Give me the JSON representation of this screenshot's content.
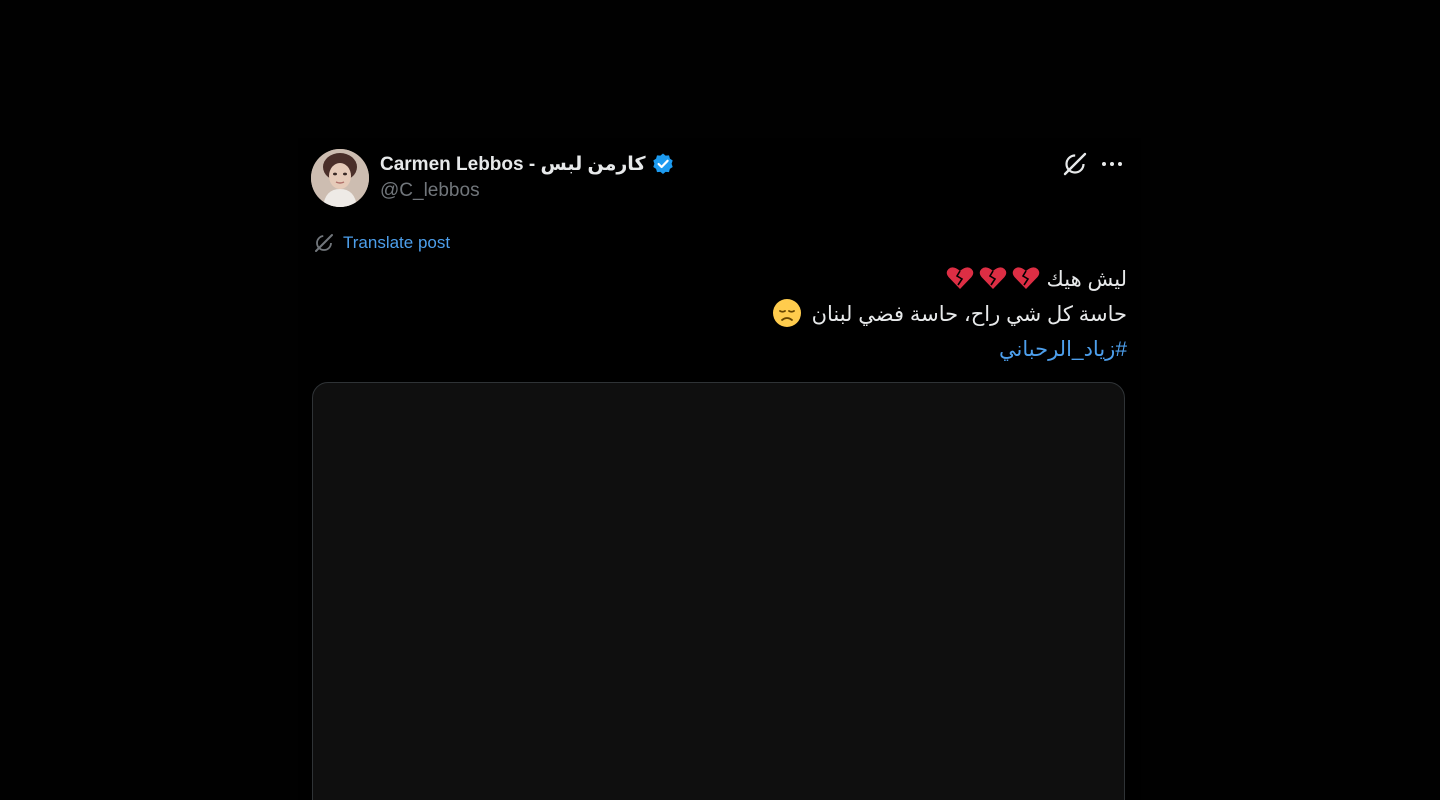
{
  "post": {
    "author": {
      "display_name": "Carmen Lebbos - كارمن لبس",
      "handle": "@C_lebbos",
      "verified": true,
      "verified_icon": "verified-badge-icon"
    },
    "header_icons": [
      "grok-icon",
      "more-options-icon"
    ],
    "translate": {
      "label": "Translate post",
      "icon": "translate-icon"
    },
    "text": {
      "line1": "ليش هيك",
      "line1_emoji": "broken-heart x3",
      "line2": "حاسة كل شي راح، حاسة فضي لبنان",
      "line2_emoji": "disappointed-face",
      "hashtag": "#زياد_الرحباني"
    },
    "colors": {
      "background": "#000000",
      "text": "#e7e9ea",
      "secondary_text": "#71767b",
      "link": "#4d9fec",
      "verified": "#1d9bf0",
      "media_border": "#2f3336"
    }
  }
}
